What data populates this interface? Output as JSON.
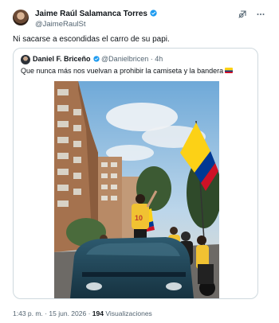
{
  "tweet": {
    "author_name": "Jaime Raúl Salamanca Torres",
    "author_handle": "@JaimeRaulSt",
    "text": "Ni sacarse a escondidas el carro de su papi.",
    "time": "1:43 p. m.",
    "separator": "·",
    "date": "15 jun. 2026",
    "views_count": "194",
    "views_label": "Visualizaciones"
  },
  "quote": {
    "author_name": "Daniel F. Briceño",
    "author_handle": "@Danielbricen",
    "separator": "·",
    "time": "4h",
    "text": "Que nunca más nos vuelvan a prohibir la camiseta y la bandera"
  },
  "icons": {
    "verified": "verified-badge-icon",
    "grok": "grok-icon",
    "more": "more-icon",
    "flag": "colombia-flag-icon"
  },
  "colors": {
    "verified": "#1d9bf0",
    "text": "#0f1419",
    "secondary": "#536471",
    "border": "#cfd9de",
    "flag_yellow": "#fcd116",
    "flag_blue": "#003893",
    "flag_red": "#ce1126"
  }
}
